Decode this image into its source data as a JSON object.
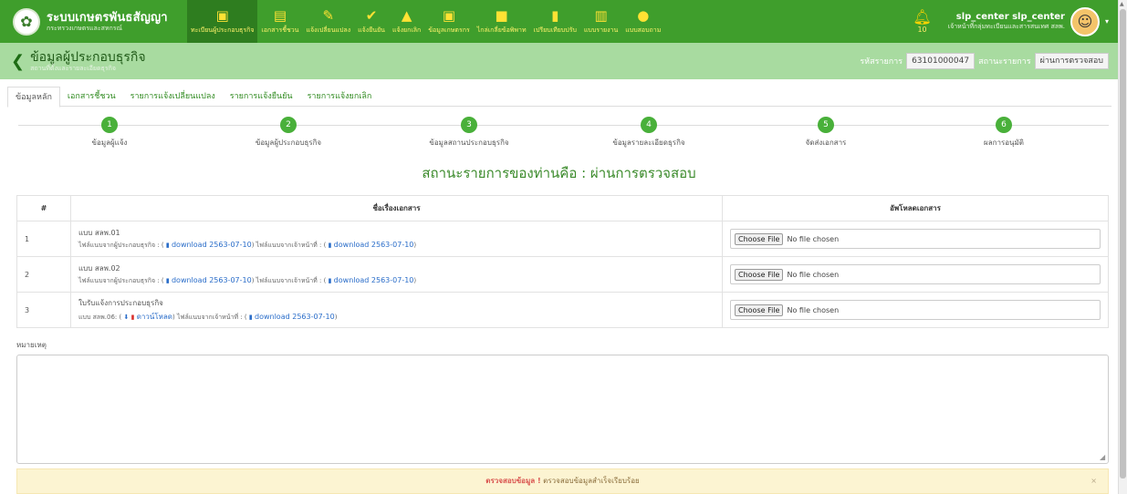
{
  "brand": {
    "title": "ระบบเกษตรพันธสัญญา",
    "subtitle": "กระทรวงเกษตรและสหกรณ์"
  },
  "nav": [
    {
      "label": "ทะเบียนผู้ประกอบธุรกิจ",
      "icon": "id-card-icon"
    },
    {
      "label": "เอกสารชี้ชวน",
      "icon": "document-icon"
    },
    {
      "label": "แจ้งเปลี่ยนแปลง",
      "icon": "edit-icon"
    },
    {
      "label": "แจ้งยืนยัน",
      "icon": "check-circle-icon"
    },
    {
      "label": "แจ้งยกเลิก",
      "icon": "warning-icon"
    },
    {
      "label": "ข้อมูลเกษตรกร",
      "icon": "id-card-icon"
    },
    {
      "label": "ไกล่เกลี่ยข้อพิพาท",
      "icon": "chat-icon"
    },
    {
      "label": "เปรียบเทียบปรับ",
      "icon": "file-icon"
    },
    {
      "label": "แบบรายงาน",
      "icon": "chart-icon"
    },
    {
      "label": "แบบสอบถาม",
      "icon": "comments-icon"
    }
  ],
  "notifications": {
    "count": "10"
  },
  "user": {
    "name": "slp_center slp_center",
    "role": "เจ้าหน้าที่กลุ่มทะเบียนและสารสนเทศ สลพ."
  },
  "page": {
    "title": "ข้อมูลผู้ประกอบธุรกิจ",
    "subtitle": "สถานที่ตั้งและรายละเอียดธุรกิจ"
  },
  "reference": {
    "code_label": "รหัสรายการ",
    "code_value": "63101000047",
    "status_label": "สถานะรายการ",
    "status_value": "ผ่านการตรวจสอบ"
  },
  "tabs": [
    "ข้อมูลหลัก",
    "เอกสารชี้ชวน",
    "รายการแจ้งเปลี่ยนแปลง",
    "รายการแจ้งยืนยัน",
    "รายการแจ้งยกเลิก"
  ],
  "steps": [
    {
      "num": "1",
      "label": "ข้อมูลผู้แจ้ง"
    },
    {
      "num": "2",
      "label": "ข้อมูลผู้ประกอบธุรกิจ"
    },
    {
      "num": "3",
      "label": "ข้อมูลสถานประกอบธุรกิจ"
    },
    {
      "num": "4",
      "label": "ข้อมูลรายละเอียดธุรกิจ"
    },
    {
      "num": "5",
      "label": "จัดส่งเอกสาร"
    },
    {
      "num": "6",
      "label": "ผลการอนุมัติ"
    }
  ],
  "status_message": "สถานะรายการของท่านคือ : ผ่านการตรวจสอบ",
  "table": {
    "headers": {
      "num": "#",
      "name": "ชื่อเรื่องเอกสาร",
      "upload": "อัพโหลดเอกสาร"
    },
    "rows": [
      {
        "num": "1",
        "title": "แบบ สลพ.01",
        "biz_label": "ไฟล์แนบจากผู้ประกอบธุรกิจ : (",
        "biz_link": "download 2563-07-10",
        "staff_label": ") ไฟล์แนบจากเจ้าหน้าที่ : (",
        "staff_link": "download 2563-07-10",
        "end": ")",
        "choose": "Choose File",
        "no_file": "No file chosen"
      },
      {
        "num": "2",
        "title": "แบบ สลพ.02",
        "biz_label": "ไฟล์แนบจากผู้ประกอบธุรกิจ : (",
        "biz_link": "download 2563-07-10",
        "staff_label": ") ไฟล์แนบจากเจ้าหน้าที่ : (",
        "staff_link": "download 2563-07-10",
        "end": ")",
        "choose": "Choose File",
        "no_file": "No file chosen"
      },
      {
        "num": "3",
        "title": "ใบรับแจ้งการประกอบธุรกิจ",
        "form_label": "แบบ สลพ.06: (",
        "form_link": "ดาวน์โหลด",
        "staff_label": ") ไฟล์แนบจากเจ้าหน้าที่ : (",
        "staff_link": "download 2563-07-10",
        "end": ")",
        "choose": "Choose File",
        "no_file": "No file chosen"
      }
    ]
  },
  "remark": {
    "label": "หมายเหตุ",
    "value": ""
  },
  "alert": {
    "strong": "ตรวจสอบข้อมูล !",
    "text": "ตรวจสอบข้อมูลสำเร็จเรียบร้อย",
    "close": "×"
  },
  "colors": {
    "primary": "#3f9e2c",
    "title_bar": "#a8dba0",
    "link": "#2a6dc9",
    "alert_bg": "#fcf4d2"
  }
}
